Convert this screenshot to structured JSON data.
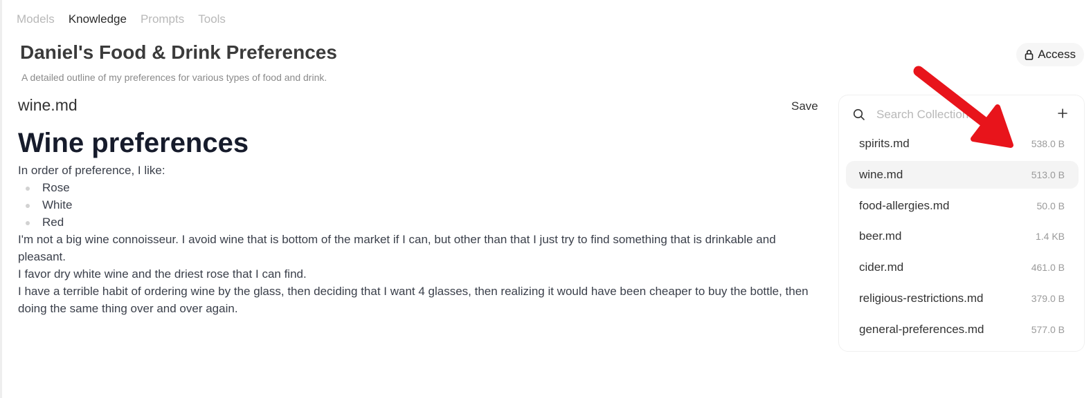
{
  "nav": {
    "tabs": [
      {
        "label": "Models",
        "active": false
      },
      {
        "label": "Knowledge",
        "active": true
      },
      {
        "label": "Prompts",
        "active": false
      },
      {
        "label": "Tools",
        "active": false
      }
    ]
  },
  "header": {
    "title": "Daniel's Food & Drink Preferences",
    "description": "A detailed outline of my preferences for various types of food and drink.",
    "access_label": "Access",
    "access_icon": "lock-icon"
  },
  "editor": {
    "file_name": "wine.md",
    "save_label": "Save",
    "heading": "Wine preferences",
    "intro": "In order of preference, I like:",
    "list": [
      "Rose",
      "White",
      "Red"
    ],
    "paragraphs": [
      "I'm not a big wine connoisseur. I avoid wine that is bottom of the market if I can, but other than that I just try to find something that is drinkable and pleasant.",
      "I favor dry white wine and the driest rose that I can find.",
      "I have a terrible habit of ordering wine by the glass, then deciding that I want 4 glasses, then realizing it would have been cheaper to buy the bottle, then doing the same thing over and over again."
    ]
  },
  "collection": {
    "search_placeholder": "Search Collection",
    "search_icon": "search-icon",
    "add_icon": "plus-icon",
    "files": [
      {
        "name": "spirits.md",
        "size": "538.0 B",
        "selected": false
      },
      {
        "name": "wine.md",
        "size": "513.0 B",
        "selected": true
      },
      {
        "name": "food-allergies.md",
        "size": "50.0 B",
        "selected": false
      },
      {
        "name": "beer.md",
        "size": "1.4 KB",
        "selected": false
      },
      {
        "name": "cider.md",
        "size": "461.0 B",
        "selected": false
      },
      {
        "name": "religious-restrictions.md",
        "size": "379.0 B",
        "selected": false
      },
      {
        "name": "general-preferences.md",
        "size": "577.0 B",
        "selected": false
      }
    ]
  },
  "annotation": {
    "arrow_color": "#e8141b"
  }
}
